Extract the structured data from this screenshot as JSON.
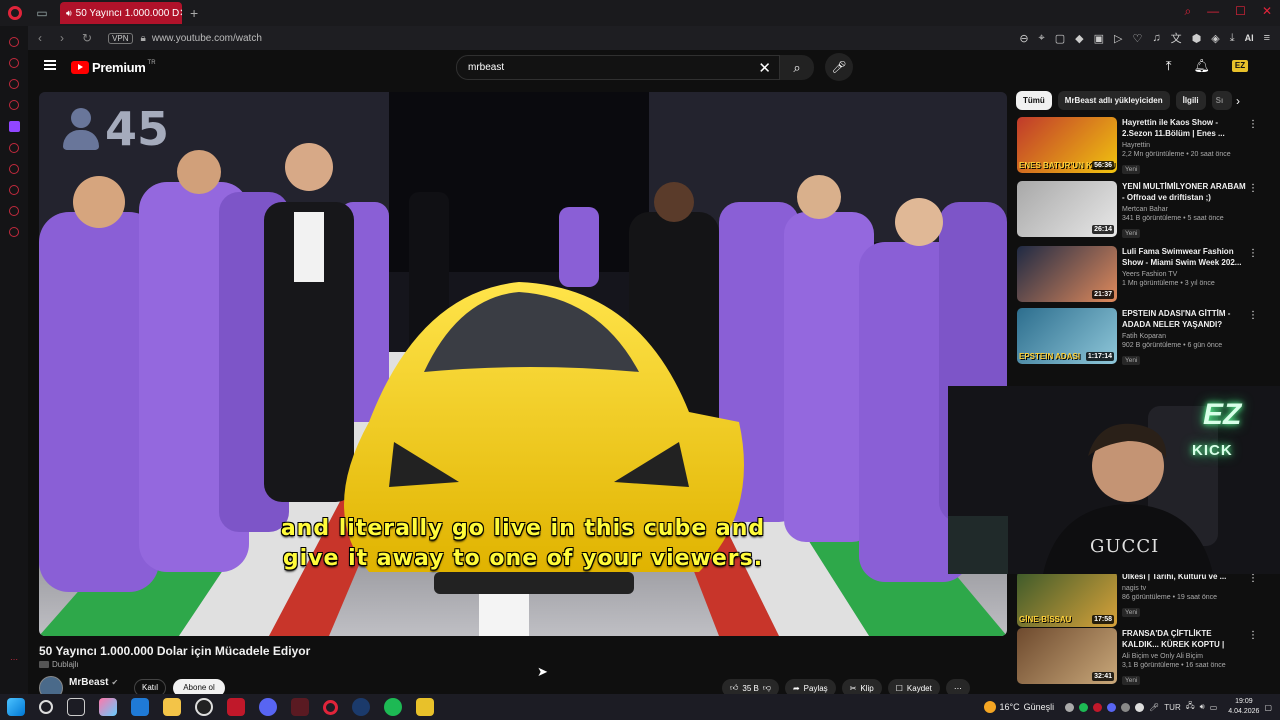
{
  "browser": {
    "tab_title": "50 Yayıncı 1.000.000 D",
    "new_tab": "+",
    "url": "www.youtube.com/watch",
    "vpn_label": "VPN",
    "ai_label": "AI"
  },
  "youtube": {
    "logo_word": "Premium",
    "logo_country": "TR",
    "search_value": "mrbeast"
  },
  "video": {
    "viewer_count": "45",
    "subtitle_line1": "and literally go live in this cube and",
    "subtitle_line2": "give it away to one of your viewers.",
    "title": "50 Yayıncı 1.000.000 Dolar için Mücadele Ediyor",
    "dub_label": "Dublajlı",
    "channel": "MrBeast",
    "join_label": "Katıl",
    "subscribe_label": "Abone ol",
    "like_count": "35 B",
    "share_label": "Paylaş",
    "clip_label": "Klip",
    "save_label": "Kaydet"
  },
  "chips": [
    "Tümü",
    "MrBeast adlı yükleyiciden",
    "İlgili",
    "Sı"
  ],
  "recommendations": [
    {
      "title": "Hayrettin ile Kaos Show - 2.Sezon 11.Bölüm | Enes ...",
      "channel": "Hayrettin",
      "views": "2,2 Mn görüntüleme • 20 saat önce",
      "badge": "Yeni",
      "duration": "56:36",
      "overlay": "ENES BATUR'UN KAOSU",
      "colors": [
        "#c0392b",
        "#f1c40f"
      ]
    },
    {
      "title": "YENİ MULTİMİLYONER ARABAM - Offroad ve driftistan ;)",
      "channel": "Mertcan Bahar",
      "views": "341 B görüntüleme • 5 saat önce",
      "badge": "Yeni",
      "duration": "26:14",
      "overlay": "",
      "colors": [
        "#a8a8a8",
        "#e8e8e8"
      ]
    },
    {
      "title": "Luli Fama Swimwear Fashion Show - Miami Swim Week 202...",
      "channel": "Yeers Fashion TV",
      "views": "1 Mn görüntüleme • 3 yıl önce",
      "badge": "",
      "duration": "21:37",
      "overlay": "",
      "colors": [
        "#1f2a44",
        "#e08a5c"
      ]
    },
    {
      "title": "EPSTEIN ADASI'NA GİTTİM - ADADA NELER YAŞANDI?",
      "channel": "Fatih Koparan",
      "views": "902 B görüntüleme • 6 gün önce",
      "badge": "Yeni",
      "duration": "1:17:14",
      "overlay": "EPSTEIN ADASI",
      "colors": [
        "#2d6e8e",
        "#8fc7d9"
      ]
    },
    {
      "title": "Ülkesi | Tarihi, Kültürü ve ...",
      "channel": "nagis tv",
      "views": "86 görüntüleme • 19 saat önce",
      "badge": "Yeni",
      "duration": "17:58",
      "overlay": "GİNE-BİSSAU",
      "colors": [
        "#3d5a2a",
        "#d8a23a"
      ]
    },
    {
      "title": "FRANSA'DA ÇİFTLİKTE KALDIK... KÜREK KOPTU | VLOG",
      "channel": "Ali Biçim ve Only Ali Biçim",
      "views": "3,1 B görüntüleme • 16 saat önce",
      "badge": "Yeni",
      "duration": "32:41",
      "overlay": "",
      "colors": [
        "#6e4a2e",
        "#c9a87a"
      ]
    }
  ],
  "webcam": {
    "logo_top": "EZ",
    "logo_bottom": "KICK",
    "shirt_text": "GUCCI"
  },
  "taskbar": {
    "weather_temp": "16°C",
    "weather_desc": "Güneşli",
    "lang": "TUR",
    "time": "19:09",
    "date": "4.04.2026"
  },
  "colors": {
    "opera_red": "#e0243a",
    "youtube_red": "#ff0000",
    "subtitle_yellow": "#fffb3a",
    "kick_green": "#5fff9a"
  }
}
